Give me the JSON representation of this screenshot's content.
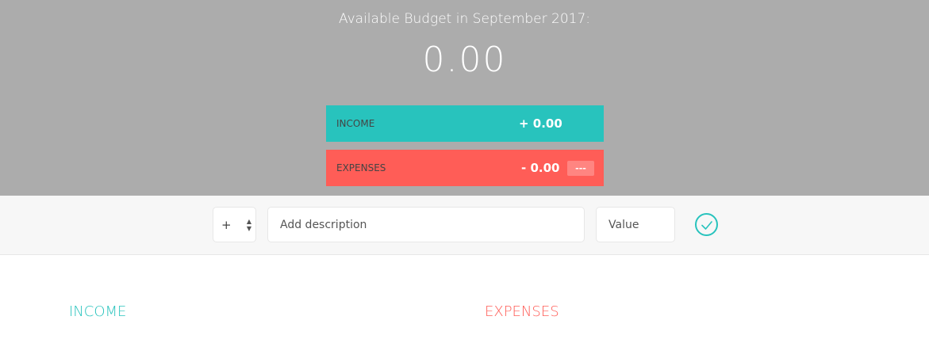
{
  "budget": {
    "title": "Available Budget in September 2017:",
    "value": "0.00",
    "income": {
      "label": "INCOME",
      "value": "+ 0.00"
    },
    "expenses": {
      "label": "EXPENSES",
      "value": "- 0.00",
      "percentage": "---"
    }
  },
  "add_form": {
    "type_value": "+",
    "description_placeholder": "Add description",
    "value_placeholder": "Value"
  },
  "lists": {
    "income_title": "Income",
    "expenses_title": "Expenses"
  },
  "colors": {
    "income": "#28c3bd",
    "expenses": "#ff5d57",
    "header_bg": "#acacac"
  }
}
